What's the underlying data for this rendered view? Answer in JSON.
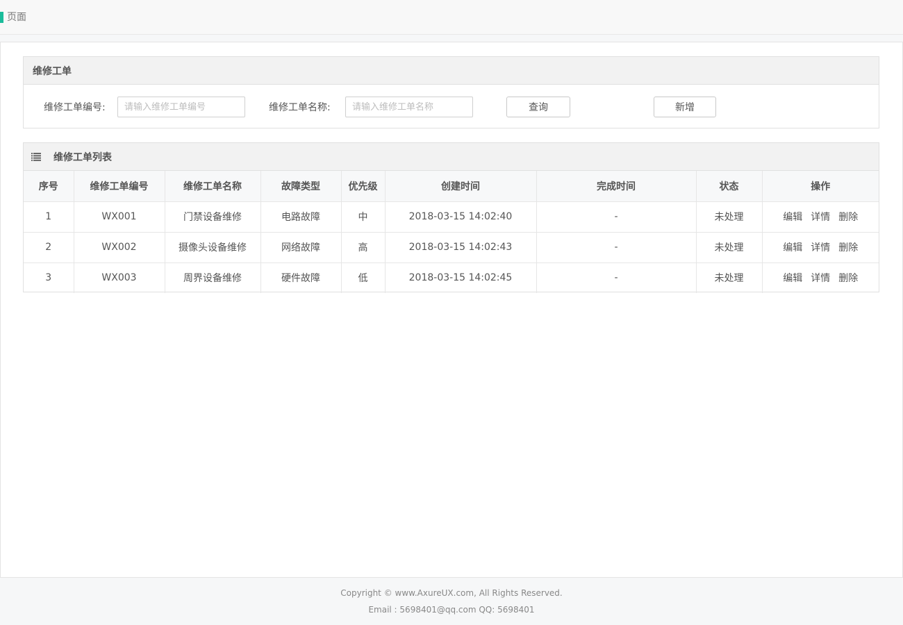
{
  "header": {
    "title": "页面",
    "accent_color": "#1bbc9b"
  },
  "search": {
    "panel_title": "维修工单",
    "code_label": "维修工单编号:",
    "code_placeholder": "请输入维修工单编号",
    "name_label": "维修工单名称:",
    "name_placeholder": "请输入维修工单名称",
    "query_button": "查询",
    "add_button": "新增"
  },
  "list": {
    "panel_title": "维修工单列表",
    "icon": "list-icon",
    "columns": [
      "序号",
      "维修工单编号",
      "维修工单名称",
      "故障类型",
      "优先级",
      "创建时间",
      "完成时间",
      "状态",
      "操作"
    ],
    "rows": [
      {
        "index": "1",
        "code": "WX001",
        "name": "门禁设备维修",
        "fault_type": "电路故障",
        "priority": "中",
        "created": "2018-03-15 14:02:40",
        "completed": "-",
        "status": "未处理"
      },
      {
        "index": "2",
        "code": "WX002",
        "name": "摄像头设备维修",
        "fault_type": "网络故障",
        "priority": "高",
        "created": "2018-03-15 14:02:43",
        "completed": "-",
        "status": "未处理"
      },
      {
        "index": "3",
        "code": "WX003",
        "name": "周界设备维修",
        "fault_type": "硬件故障",
        "priority": "低",
        "created": "2018-03-15 14:02:45",
        "completed": "-",
        "status": "未处理"
      }
    ],
    "actions": {
      "edit": "编辑",
      "detail": "详情",
      "delete": "删除"
    }
  },
  "footer": {
    "copyright": "Copyright © www.AxureUX.com, All Rights Reserved.",
    "contact": "Email : 5698401@qq.com  QQ: 5698401"
  }
}
